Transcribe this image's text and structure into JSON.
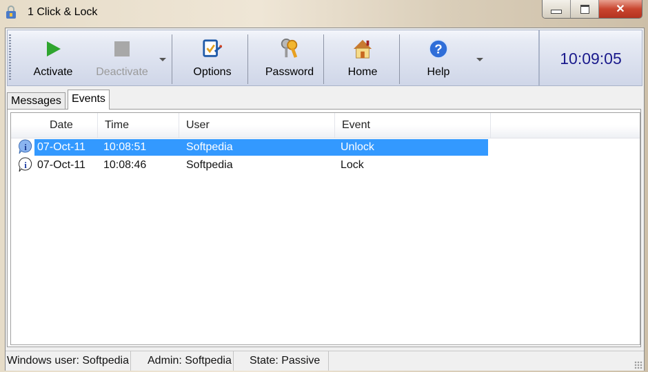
{
  "window": {
    "title": "1 Click & Lock",
    "controls": {
      "minimize": "minimize",
      "maximize": "maximize",
      "close": "close"
    }
  },
  "toolbar": {
    "buttons": [
      {
        "label": "Activate",
        "icon": "play-icon",
        "enabled": true
      },
      {
        "label": "Deactivate",
        "icon": "stop-icon",
        "enabled": false
      },
      {
        "label": "Options",
        "icon": "options-checklist-icon",
        "enabled": true
      },
      {
        "label": "Password",
        "icon": "keys-icon",
        "enabled": true
      },
      {
        "label": "Home",
        "icon": "home-icon",
        "enabled": true
      },
      {
        "label": "Help",
        "icon": "help-icon",
        "enabled": true
      }
    ],
    "clock": "10:09:05"
  },
  "tabs": [
    {
      "label": "Messages",
      "active": false
    },
    {
      "label": "Events",
      "active": true
    }
  ],
  "events_table": {
    "columns": [
      "Date",
      "Time",
      "User",
      "Event"
    ],
    "rows": [
      {
        "date": "07-Oct-11",
        "time": "10:08:51",
        "user": "Softpedia",
        "event": "Unlock",
        "selected": true,
        "icon": "info-icon"
      },
      {
        "date": "07-Oct-11",
        "time": "10:08:46",
        "user": "Softpedia",
        "event": "Lock",
        "selected": false,
        "icon": "info-icon"
      }
    ]
  },
  "statusbar": {
    "windows_user": "Windows user:  Softpedia",
    "admin": "Admin:  Softpedia",
    "state": "State:  Passive"
  },
  "colors": {
    "selection": "#3399ff",
    "clock": "#1a1a8c",
    "close_button": "#c9452f"
  }
}
